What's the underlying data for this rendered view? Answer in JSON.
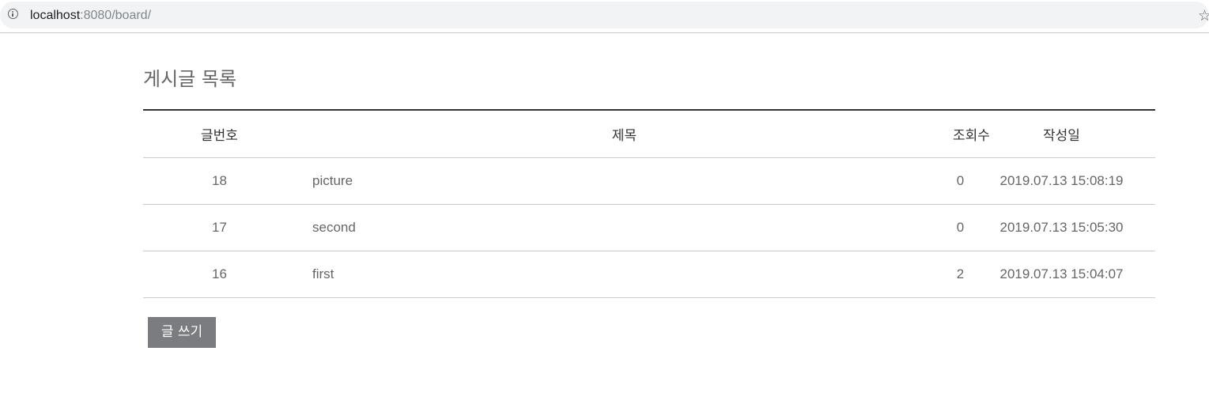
{
  "browser": {
    "url_host": "localhost",
    "url_rest": ":8080/board/",
    "icons": {
      "info": "info-circle-icon",
      "bookmark": "star-outline-icon"
    }
  },
  "board": {
    "title": "게시글 목록",
    "columns": [
      "글번호",
      "제목",
      "조회수",
      "작성일"
    ],
    "rows": [
      {
        "no": "18",
        "title": "picture",
        "views": "0",
        "date": "2019.07.13 15:08:19"
      },
      {
        "no": "17",
        "title": "second",
        "views": "0",
        "date": "2019.07.13 15:05:30"
      },
      {
        "no": "16",
        "title": "first",
        "views": "2",
        "date": "2019.07.13 15:04:07"
      }
    ],
    "write_label": "글 쓰기"
  },
  "colors": {
    "button_bg": "#7b7c80",
    "header_rule": "#333333",
    "row_rule": "#cccccc"
  }
}
